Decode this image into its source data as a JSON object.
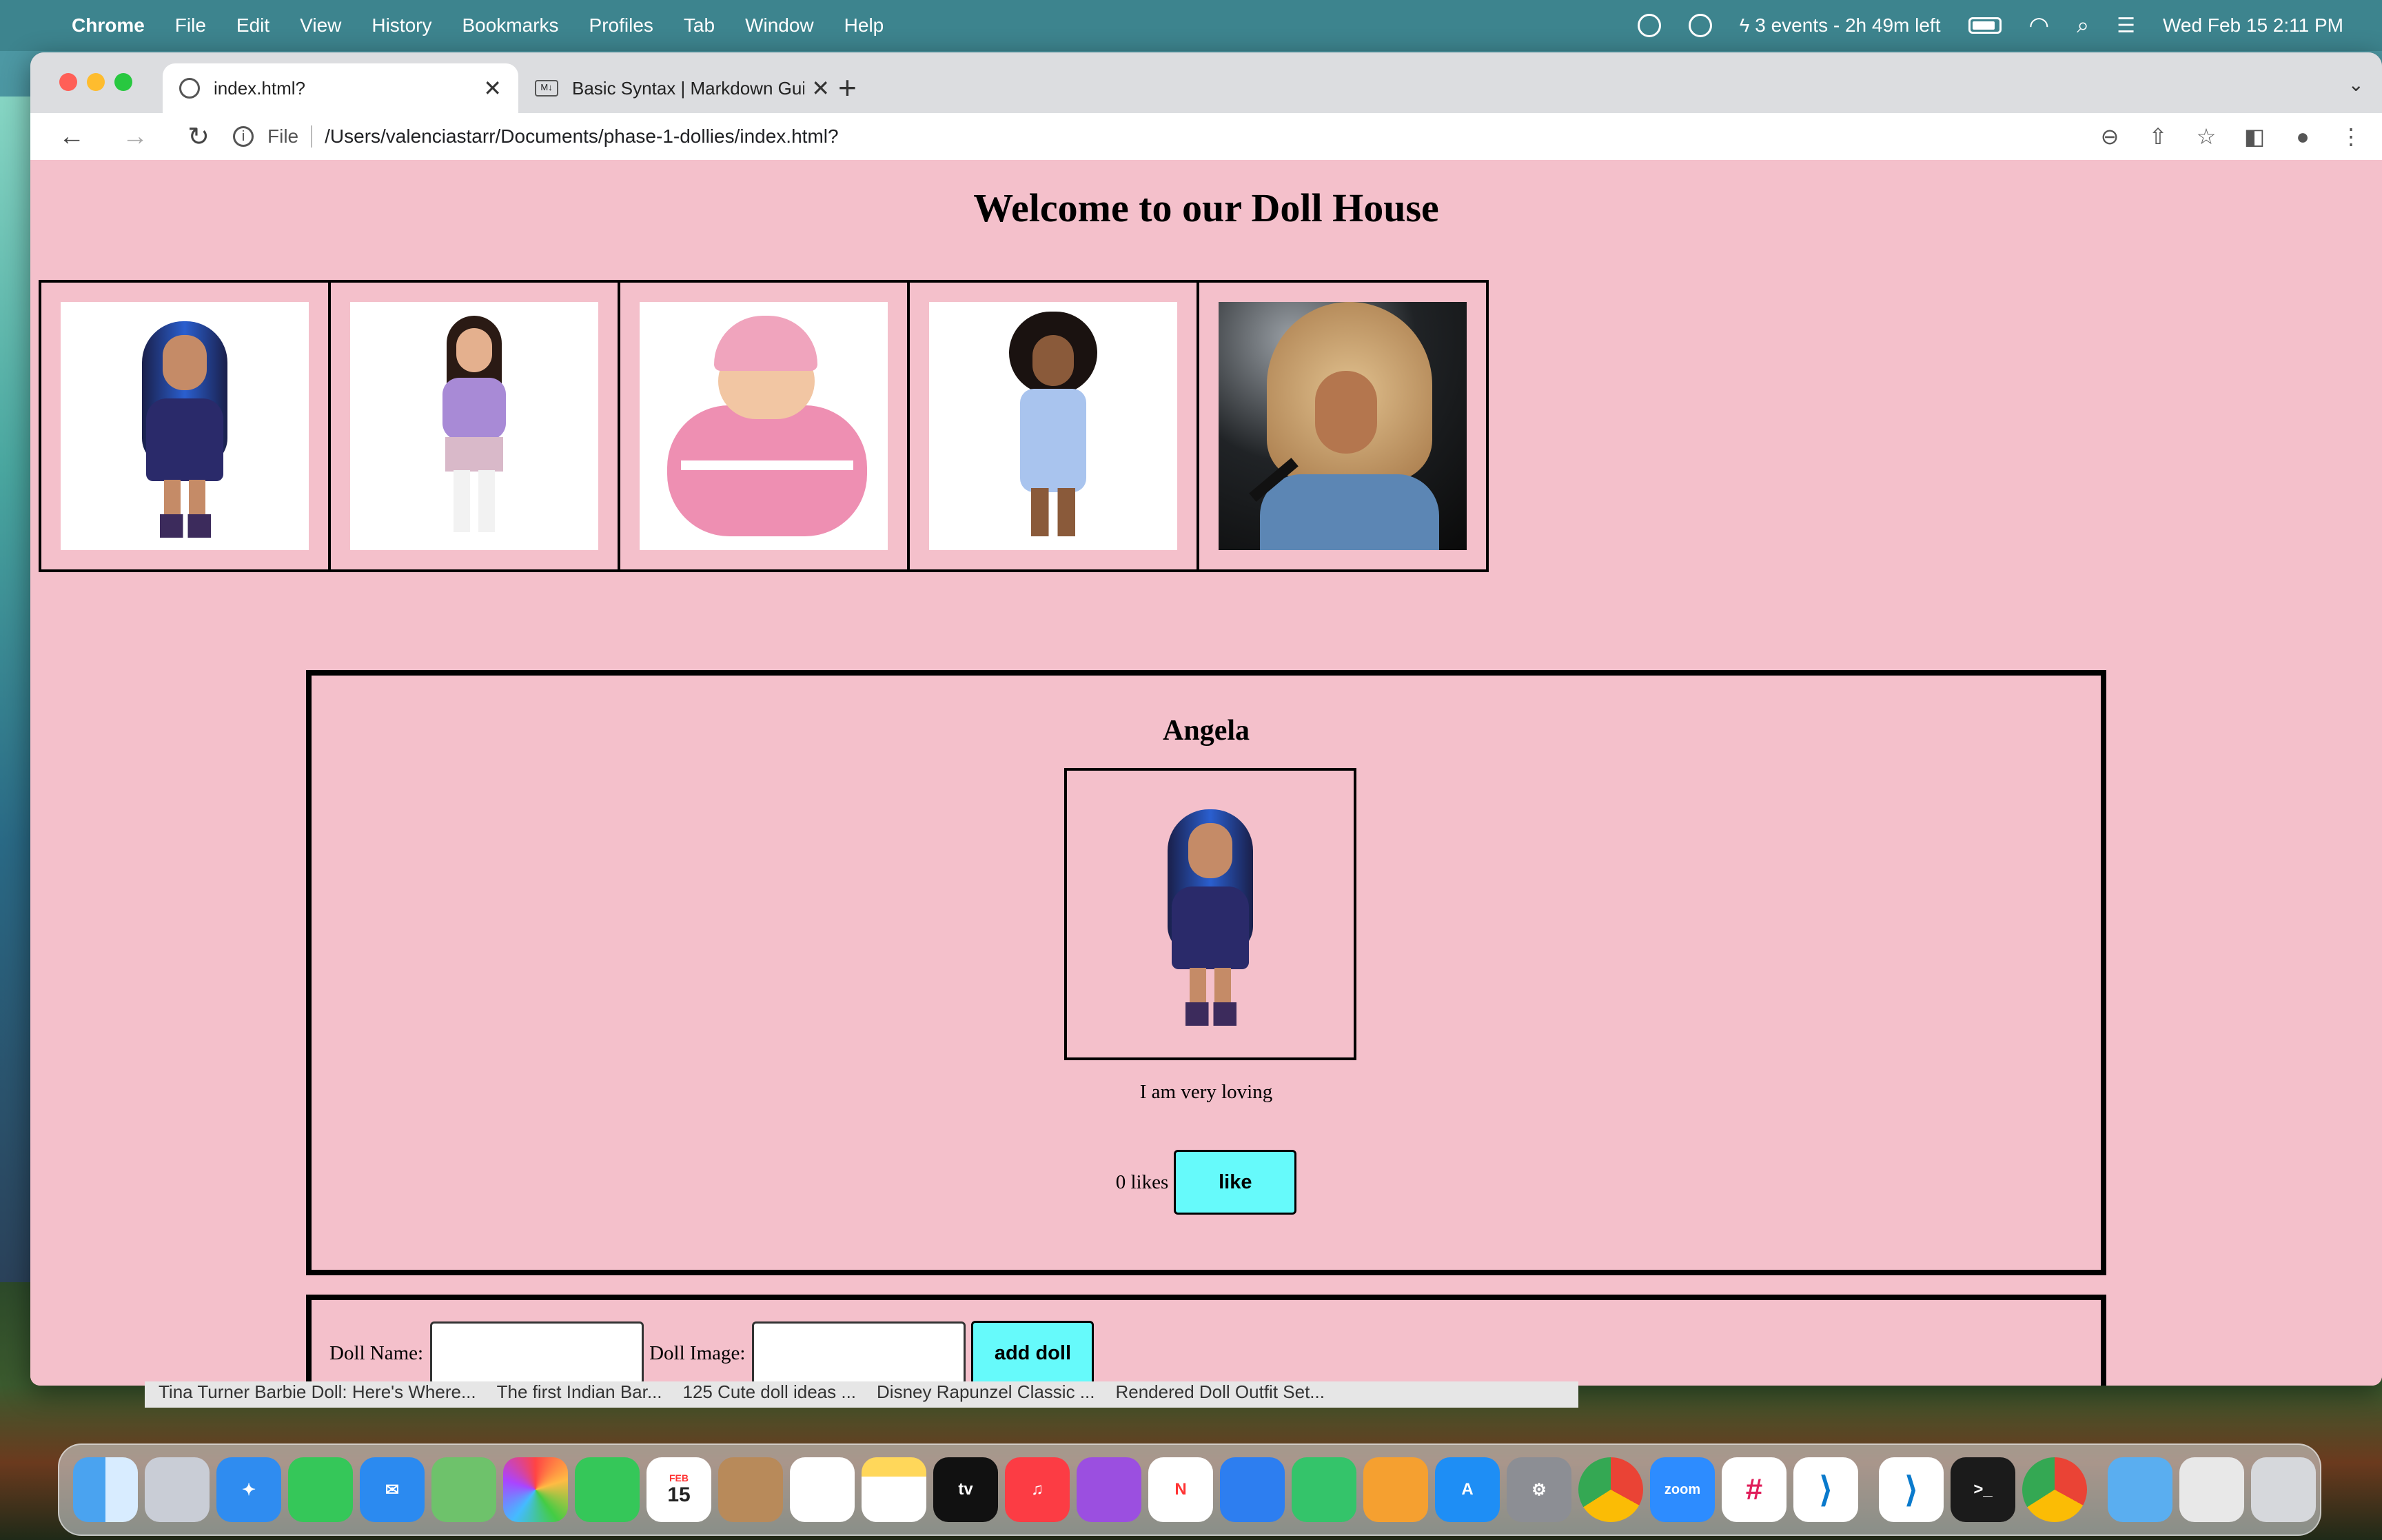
{
  "menubar": {
    "app": "Chrome",
    "items": [
      "File",
      "Edit",
      "View",
      "History",
      "Bookmarks",
      "Profiles",
      "Tab",
      "Window",
      "Help"
    ],
    "status_events": "3 events - 2h 49m left",
    "datetime": "Wed Feb 15  2:11 PM"
  },
  "browser": {
    "tabs": [
      {
        "label": "index.html?",
        "active": true
      },
      {
        "label": "Basic Syntax | Markdown Guide",
        "active": false
      }
    ],
    "new_tab": "+",
    "address": {
      "scheme": "File",
      "url": "/Users/valenciastarr/Documents/phase-1-dollies/index.html?"
    }
  },
  "page": {
    "title": "Welcome to our Doll House",
    "doll_bar": [
      {
        "alt": "doll with blue-streaked long hair"
      },
      {
        "alt": "doll with dark braids and lavender sweater"
      },
      {
        "alt": "baby doll in pink outfit"
      },
      {
        "alt": "doll with curly hair and denim overalls"
      },
      {
        "alt": "rock star doll with big blonde hair"
      }
    ],
    "selected_doll": {
      "name": "Angela",
      "description": "I am very loving",
      "likes": "0 likes",
      "like_button": "like"
    },
    "form": {
      "name_label": "Doll Name:",
      "image_label": "Doll Image:",
      "name_value": "",
      "image_value": "",
      "submit": "add doll"
    }
  },
  "background_tabs": [
    "Tina Turner Barbie Doll: Here's Where...",
    "The first Indian Bar...",
    "125 Cute doll ideas ...",
    "Disney Rapunzel Classic ...",
    "Rendered Doll Outfit Set..."
  ],
  "dock": {
    "apps": [
      "finder-icon",
      "launchpad-icon",
      "safari-icon",
      "messages-icon",
      "mail-icon",
      "maps-icon",
      "photos-icon",
      "facetime-icon",
      "calendar-icon",
      "contacts-icon",
      "reminders-icon",
      "notes-icon",
      "appletv-icon",
      "music-icon",
      "podcasts-icon",
      "news-icon",
      "keynote-icon",
      "numbers-icon",
      "pages-icon",
      "appstore-icon",
      "settings-icon",
      "chrome-icon",
      "zoom-icon",
      "slack-icon",
      "vscode-icon",
      "vscode-icon-2",
      "terminal-icon",
      "chrome-icon-2",
      "folder-icon",
      "preview-icon",
      "trash-icon"
    ],
    "calendar_month": "FEB",
    "calendar_day": "15",
    "appletv_label": "tv",
    "zoom_label": "zoom"
  }
}
